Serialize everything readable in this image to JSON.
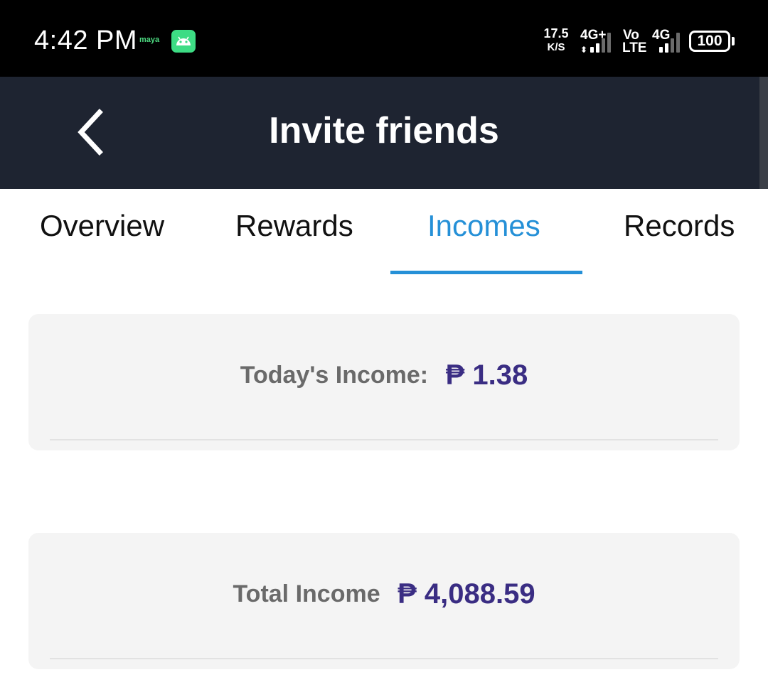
{
  "status_bar": {
    "time": "4:42 PM",
    "notification_app": "maya",
    "network_speed_value": "17.5",
    "network_speed_unit": "K/S",
    "sim1_network": "4G+",
    "volte_top": "Vo",
    "volte_bottom": "LTE",
    "sim2_network": "4G",
    "battery_level": "100",
    "icons": [
      "android-icon",
      "signal-icon",
      "battery-icon"
    ]
  },
  "app_bar": {
    "title": "Invite friends",
    "back_icon": "chevron-left-icon",
    "background_color": "#1e2431"
  },
  "tabs": [
    {
      "label": "Overview",
      "active": false
    },
    {
      "label": "Rewards",
      "active": false
    },
    {
      "label": "Incomes",
      "active": true
    },
    {
      "label": "Records",
      "active": false
    }
  ],
  "accent_color": "#2590d7",
  "value_color": "#3a2d83",
  "incomes": {
    "today": {
      "label": "Today's Income:",
      "value": "₱ 1.38"
    },
    "total": {
      "label": "Total Income",
      "value": "₱ 4,088.59"
    }
  }
}
